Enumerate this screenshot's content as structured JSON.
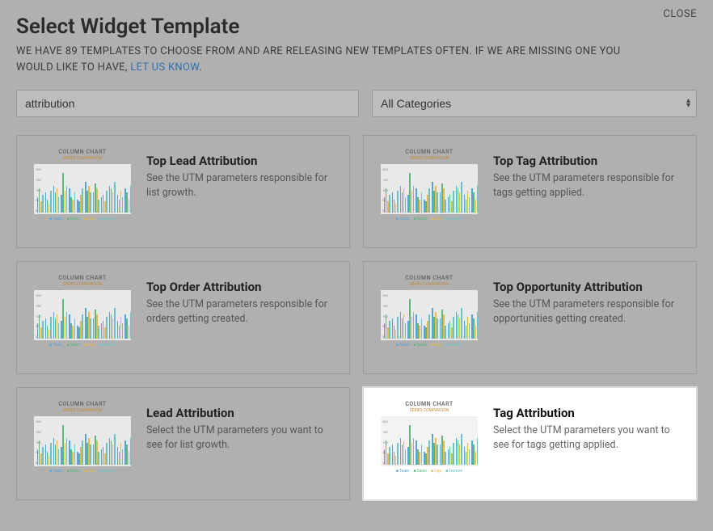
{
  "close_label": "CLOSE",
  "title": "Select Widget Template",
  "subtitle_pre": "WE HAVE 89 TEMPLATES TO CHOOSE FROM AND ARE RELEASING NEW TEMPLATES OFTEN. IF WE ARE MISSING ONE YOU WOULD LIKE TO HAVE, ",
  "subtitle_link": "LET US KNOW",
  "subtitle_post": ".",
  "search": {
    "value": "attribution",
    "placeholder": ""
  },
  "category": {
    "selected": "All Categories"
  },
  "thumb": {
    "title": "COLUMN CHART",
    "sub": "SERIES COMPARISON",
    "legend": [
      "Team",
      "Sales",
      "Opp",
      "Feature"
    ],
    "yticks": [
      "200",
      "150",
      "100",
      "50",
      "0"
    ]
  },
  "cards": [
    {
      "title": "Top Lead Attribution",
      "desc": "See the UTM parameters responsible for list growth.",
      "highlight": false
    },
    {
      "title": "Top Tag Attribution",
      "desc": "See the UTM parameters responsible for tags getting applied.",
      "highlight": false
    },
    {
      "title": "Top Order Attribution",
      "desc": "See the UTM parameters responsible for orders getting created.",
      "highlight": false
    },
    {
      "title": "Top Opportunity Attribution",
      "desc": "See the UTM parameters responsible for opportunities getting created.",
      "highlight": false
    },
    {
      "title": "Lead Attribution",
      "desc": "Select the UTM parameters you want to see for list growth.",
      "highlight": false
    },
    {
      "title": "Tag Attribution",
      "desc": "Select the UTM parameters you want to see for tags getting applied.",
      "highlight": true
    }
  ],
  "chart_data": {
    "type": "bar",
    "note": "Thumbnail preview — approximate grouped bar heights in percent of axis",
    "series_colors": [
      "#5aa3d8",
      "#5fb77a",
      "#e7b84d",
      "#6ec1c9"
    ],
    "groups": 12,
    "values_pct": [
      [
        35,
        55,
        25,
        40
      ],
      [
        45,
        30,
        20,
        50
      ],
      [
        60,
        45,
        55,
        35
      ],
      [
        40,
        90,
        50,
        60
      ],
      [
        55,
        35,
        30,
        45
      ],
      [
        30,
        25,
        40,
        55
      ],
      [
        70,
        50,
        60,
        45
      ],
      [
        45,
        65,
        55,
        30
      ],
      [
        35,
        40,
        25,
        50
      ],
      [
        60,
        55,
        45,
        70
      ],
      [
        40,
        30,
        50,
        35
      ],
      [
        55,
        45,
        30,
        60
      ]
    ]
  }
}
